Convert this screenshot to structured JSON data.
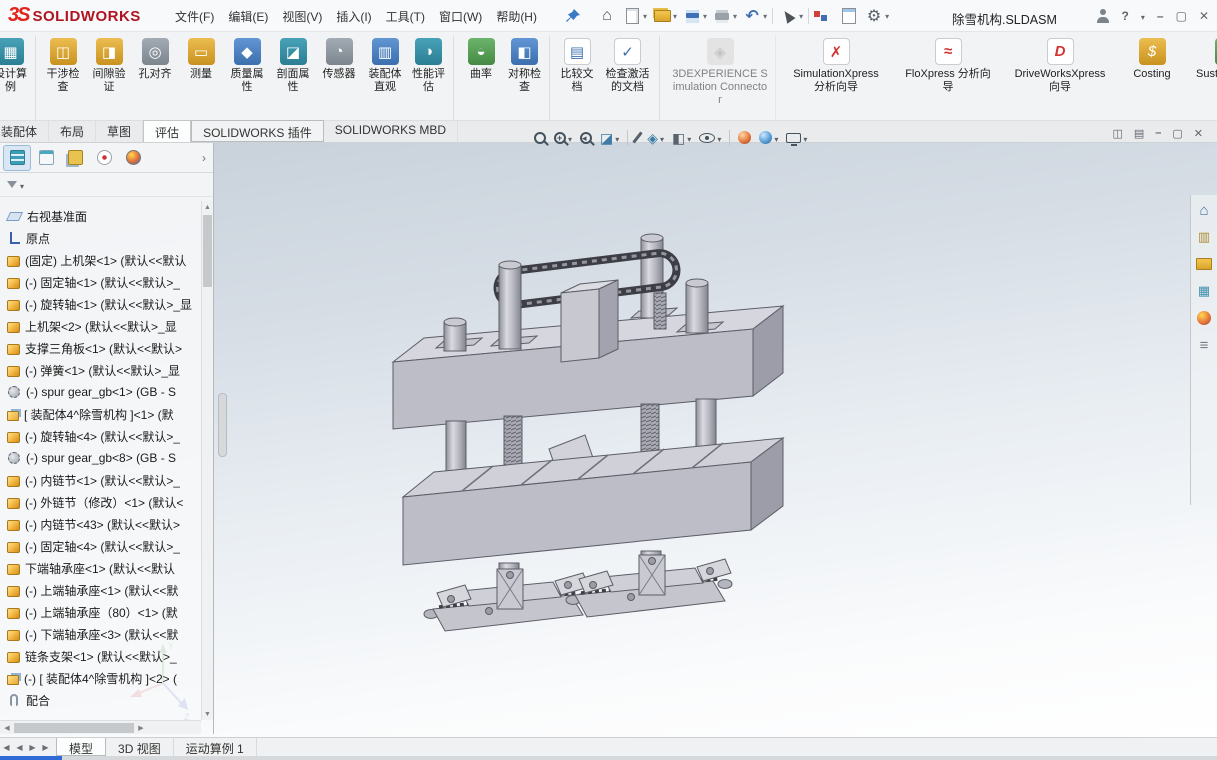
{
  "titlebar": {
    "logo_mark": "3S",
    "logo_text": "SOLIDWORKS",
    "menus": [
      "文件(F)",
      "编辑(E)",
      "视图(V)",
      "插入(I)",
      "工具(T)",
      "窗口(W)",
      "帮助(H)"
    ],
    "doc_title": "除雪机构.SLDASM",
    "window_controls": [
      "user",
      "help",
      "minimize",
      "restore",
      "close"
    ]
  },
  "qat": {
    "icons": [
      {
        "name": "home-icon",
        "icon": "home",
        "mods": ""
      },
      {
        "name": "new-document-icon",
        "icon": "newdoc",
        "mods": "hasdd"
      },
      {
        "name": "open-icon",
        "icon": "open",
        "mods": "hasdd"
      },
      {
        "name": "save-icon",
        "icon": "save",
        "mods": "hasdd"
      },
      {
        "name": "print-icon",
        "icon": "print",
        "mods": "hasdd"
      },
      {
        "name": "undo-icon",
        "icon": "undo",
        "mods": "hasdd"
      },
      {
        "name": "separator",
        "icon": "sep",
        "mods": ""
      },
      {
        "name": "select-icon",
        "icon": "select",
        "mods": "hasdd"
      },
      {
        "name": "separator",
        "icon": "sep",
        "mods": ""
      },
      {
        "name": "rebuild-icon",
        "icon": "rebuild",
        "mods": ""
      },
      {
        "name": "file-properties-icon",
        "icon": "sheet",
        "mods": ""
      },
      {
        "name": "options-icon",
        "icon": "gear",
        "mods": "hasdd"
      }
    ]
  },
  "ribbon": {
    "tools": [
      {
        "name": "design-study-tool",
        "label": "设计算例",
        "glyph": "▦",
        "color": "c-teal",
        "mods": "sep-after"
      },
      {
        "name": "interference-detection-tool",
        "label": "干涉检查",
        "glyph": "◫",
        "color": "c-gold",
        "mods": ""
      },
      {
        "name": "clearance-verification-tool",
        "label": "间隙验证",
        "glyph": "◨",
        "color": "c-gold",
        "mods": ""
      },
      {
        "name": "hole-alignment-tool",
        "label": "孔对齐",
        "glyph": "◎",
        "color": "c-gray",
        "mods": ""
      },
      {
        "name": "measure-tool",
        "label": "测量",
        "glyph": "▭",
        "color": "c-gold",
        "mods": ""
      },
      {
        "name": "mass-properties-tool",
        "label": "质量属性",
        "glyph": "◆",
        "color": "c-blue",
        "mods": ""
      },
      {
        "name": "section-properties-tool",
        "label": "剖面属性",
        "glyph": "◪",
        "color": "c-teal",
        "mods": ""
      },
      {
        "name": "sensor-tool",
        "label": "传感器",
        "glyph": "◔",
        "color": "c-gray",
        "mods": ""
      },
      {
        "name": "assembly-visualization-tool",
        "label": "装配体直观",
        "glyph": "▥",
        "color": "c-blue",
        "mods": ""
      },
      {
        "name": "performance-evaluation-tool",
        "label": "性能评估",
        "glyph": "◑",
        "color": "c-teal",
        "mods": "sep-after"
      },
      {
        "name": "curvature-tool",
        "label": "曲率",
        "glyph": "◒",
        "color": "c-green",
        "mods": ""
      },
      {
        "name": "symmetry-check-tool",
        "label": "对称检查",
        "glyph": "◧",
        "color": "c-blue",
        "mods": "sep-after"
      },
      {
        "name": "compare-documents-tool",
        "label": "比较文档",
        "glyph": "▤",
        "color": "c-white",
        "mods": ""
      },
      {
        "name": "check-active-document-tool",
        "label": "检查激活的文档",
        "glyph": "✓",
        "color": "c-white",
        "mods": "mid sep-after"
      },
      {
        "name": "3dexperience-simulation-connector",
        "label": "3DEXPERIENCE Simulation Connector",
        "glyph": "◈",
        "color": "c-dis",
        "mods": "wide disabled sep-after"
      },
      {
        "name": "simulationxpress-wizard",
        "label": "SimulationXpress 分析向导",
        "glyph": "✗",
        "color": "c-xp",
        "mods": "wide"
      },
      {
        "name": "floxpress-wizard",
        "label": "FloXpress 分析向导",
        "glyph": "≈",
        "color": "c-xp",
        "mods": "wide"
      },
      {
        "name": "driveworksxpress-wizard",
        "label": "DriveWorksXpress 向导",
        "glyph": "D",
        "color": "c-xp",
        "mods": "wide"
      },
      {
        "name": "costing-tool",
        "label": "Costing",
        "glyph": "$",
        "color": "c-gold",
        "mods": "wide"
      },
      {
        "name": "sustainability-tool",
        "label": "Sustainability",
        "glyph": "♻",
        "color": "c-green",
        "mods": "wide"
      }
    ]
  },
  "command_tabs": [
    {
      "label": "装配体",
      "name": "tab-assembly",
      "mods": ""
    },
    {
      "label": "布局",
      "name": "tab-layout",
      "mods": ""
    },
    {
      "label": "草图",
      "name": "tab-sketch",
      "mods": ""
    },
    {
      "label": "评估",
      "name": "tab-evaluate",
      "mods": "active"
    },
    {
      "label": "SOLIDWORKS 插件",
      "name": "tab-solidworks-addins",
      "mods": "boxed"
    },
    {
      "label": "SOLIDWORKS MBD",
      "name": "tab-solidworks-mbd",
      "mods": ""
    }
  ],
  "view_toolbar": [
    "zoom-fit",
    "zoom-area",
    "previous-view",
    "section-view",
    "annotation-views",
    "view-orientation",
    "display-style",
    "hide-show-items",
    "edit-appearance",
    "apply-scene",
    "view-settings"
  ],
  "viewport_controls": [
    "pane-left",
    "pane-right",
    "minimize",
    "restore",
    "close"
  ],
  "feature_panel": {
    "manager_tabs": [
      "feature-manager",
      "property-manager",
      "configuration-manager",
      "dimxpert-manager",
      "display-manager"
    ],
    "tree": [
      {
        "icon": "plane",
        "label": "右视基准面",
        "name": "tree-item-plane"
      },
      {
        "icon": "origin",
        "label": "原点",
        "name": "tree-item-origin"
      },
      {
        "icon": "part",
        "label": "(固定) 上机架<1> (默认<<默认",
        "name": "tree-item-component"
      },
      {
        "icon": "part",
        "label": "(-) 固定轴<1> (默认<<默认>_",
        "name": "tree-item-component"
      },
      {
        "icon": "part",
        "label": "(-) 旋转轴<1> (默认<<默认>_显",
        "name": "tree-item-component"
      },
      {
        "icon": "part",
        "label": "上机架<2> (默认<<默认>_显",
        "name": "tree-item-component"
      },
      {
        "icon": "part",
        "label": "支撑三角板<1> (默认<<默认>",
        "name": "tree-item-component"
      },
      {
        "icon": "part",
        "label": "(-) 弹簧<1> (默认<<默认>_显",
        "name": "tree-item-component"
      },
      {
        "icon": "gear",
        "label": "(-) spur gear_gb<1> (GB - S",
        "name": "tree-item-component"
      },
      {
        "icon": "asm",
        "label": "[ 装配体4^除雪机构 ]<1> (默",
        "name": "tree-item-subassembly"
      },
      {
        "icon": "part",
        "label": "(-) 旋转轴<4> (默认<<默认>_",
        "name": "tree-item-component"
      },
      {
        "icon": "gear",
        "label": "(-) spur gear_gb<8> (GB - S",
        "name": "tree-item-component"
      },
      {
        "icon": "part",
        "label": "(-) 内链节<1> (默认<<默认>_",
        "name": "tree-item-component"
      },
      {
        "icon": "part",
        "label": "(-) 外链节（修改）<1> (默认<",
        "name": "tree-item-component"
      },
      {
        "icon": "part",
        "label": "(-) 内链节<43> (默认<<默认>",
        "name": "tree-item-component"
      },
      {
        "icon": "part",
        "label": "(-) 固定轴<4> (默认<<默认>_",
        "name": "tree-item-component"
      },
      {
        "icon": "part",
        "label": "下端轴承座<1> (默认<<默认",
        "name": "tree-item-component"
      },
      {
        "icon": "part",
        "label": "(-) 上端轴承座<1> (默认<<默",
        "name": "tree-item-component"
      },
      {
        "icon": "part",
        "label": "(-) 上端轴承座（80）<1> (默",
        "name": "tree-item-component"
      },
      {
        "icon": "part",
        "label": "(-) 下端轴承座<3> (默认<<默",
        "name": "tree-item-component"
      },
      {
        "icon": "part",
        "label": "链条支架<1> (默认<<默认>_",
        "name": "tree-item-component"
      },
      {
        "icon": "asm",
        "label": "(-) [ 装配体4^除雪机构 ]<2> (",
        "name": "tree-item-subassembly"
      },
      {
        "icon": "mates",
        "label": "配合",
        "name": "tree-item-mates"
      }
    ]
  },
  "task_pane": [
    "resources-home",
    "design-library",
    "file-explorer",
    "view-palette",
    "appearances",
    "custom-properties"
  ],
  "triad": {
    "x": "X",
    "y": "Y",
    "z": "Z"
  },
  "bottom": {
    "nav": [
      "scroll-first",
      "scroll-prev",
      "scroll-next",
      "scroll-last"
    ],
    "tabs": [
      {
        "label": "模型",
        "name": "tab-model",
        "mods": "active"
      },
      {
        "label": "3D 视图",
        "name": "tab-3d-views",
        "mods": ""
      },
      {
        "label": "运动算例 1",
        "name": "tab-motion-study-1",
        "mods": ""
      }
    ]
  }
}
